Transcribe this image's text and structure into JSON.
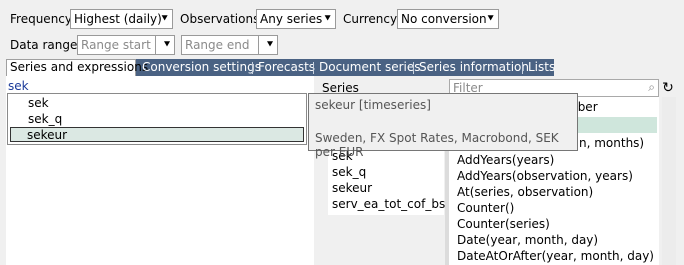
{
  "toolbar": {
    "frequency_label": "Frequency",
    "frequency_value": "Highest (daily)",
    "observations_label": "Observations",
    "observations_value": "Any series",
    "currency_label": "Currency",
    "currency_value": "No conversion",
    "data_range_label": "Data range",
    "range_start_placeholder": "Range start",
    "range_end_placeholder": "Range end"
  },
  "tabs": [
    {
      "label": "Series and expressions",
      "active": true
    },
    {
      "label": "Conversion settings"
    },
    {
      "label": "Forecasts"
    },
    {
      "label": "Document series"
    },
    {
      "label": "Series information"
    },
    {
      "label": "Lists"
    }
  ],
  "editor": {
    "text": "sek",
    "suggestions": [
      "sek",
      "sek_q",
      "sekeur"
    ],
    "selected": "sekeur"
  },
  "tooltip": {
    "title": "sekeur [timeseries]",
    "description": "Sweden, FX Spot Rates, Macrobond, SEK per EUR"
  },
  "series_panel": {
    "header": "Series",
    "items": [
      "sek",
      "sek_q",
      "sekeur",
      "serv_ea_tot_cof_bs_m"
    ]
  },
  "functions_panel": {
    "filter_placeholder": "Filter",
    "header_partial": "mber",
    "items": [
      "n, months)",
      "AddYears(years)",
      "AddYears(observation, years)",
      "At(series, observation)",
      "Counter()",
      "Counter(series)",
      "Date(year, month, day)",
      "DateAtOrAfter(year, month, day)"
    ]
  },
  "colors": {
    "tab_bar": "#4a6283",
    "selection": "#dbe8e3",
    "highlight": "#cfe6dc"
  }
}
